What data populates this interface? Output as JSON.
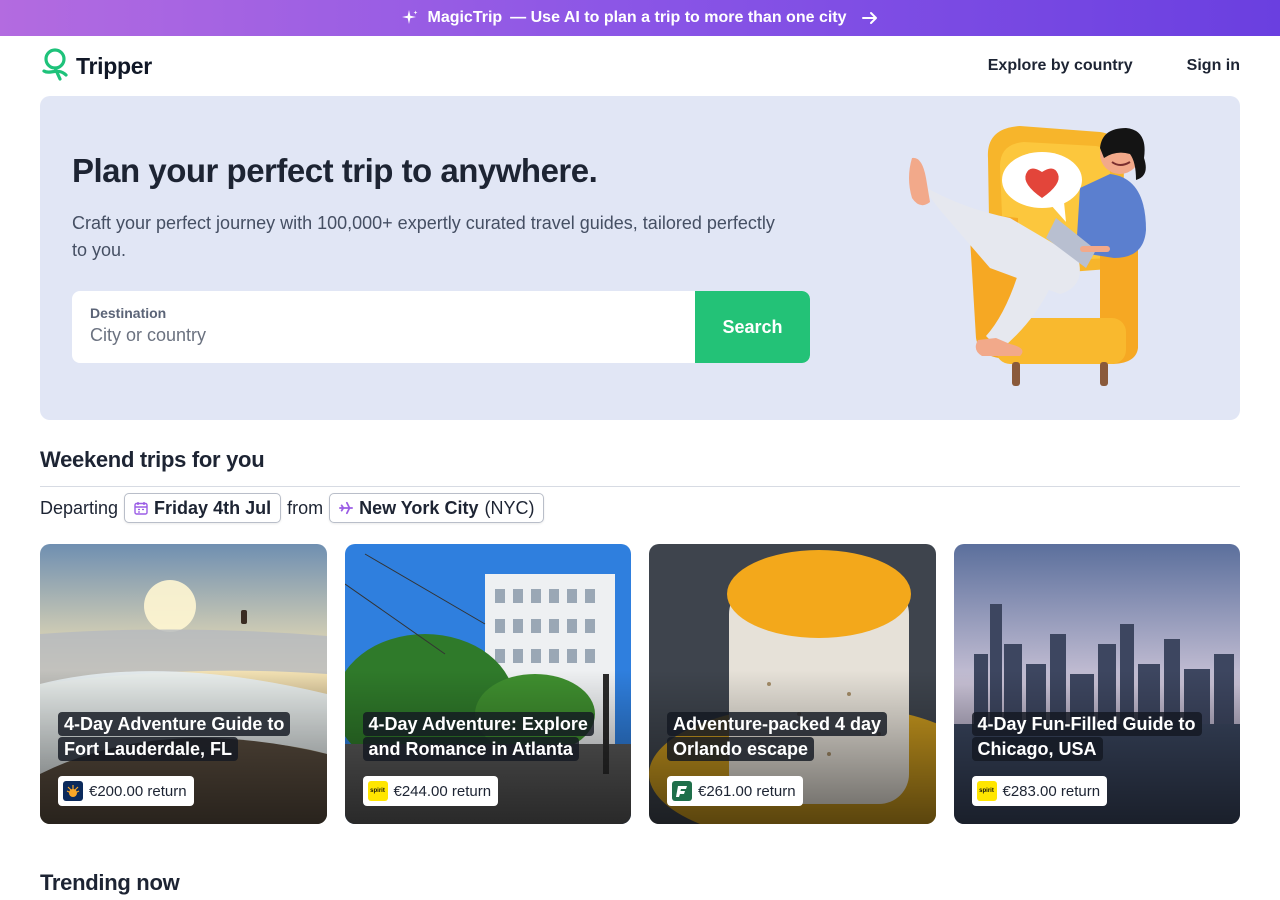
{
  "promo": {
    "brand": "MagicTrip",
    "text": "— Use AI to plan a trip to more than one city",
    "colors": {
      "start": "#b36be0",
      "end": "#6a3fe0"
    }
  },
  "header": {
    "logo_text": "Tripper",
    "nav": {
      "explore_label": "Explore by country",
      "signin_label": "Sign in"
    }
  },
  "hero": {
    "title": "Plan your perfect trip to anywhere.",
    "subtitle": "Craft your perfect journey with 100,000+ expertly curated travel guides, tailored perfectly to you.",
    "search": {
      "label": "Destination",
      "placeholder": "City or country",
      "value": "",
      "button_label": "Search"
    },
    "accent_color": "#23c277"
  },
  "weekend": {
    "title": "Weekend trips for you",
    "departing_label": "Departing",
    "date": "Friday 4th Jul",
    "from_label": "from",
    "city": "New York City",
    "city_code": "(NYC)",
    "cards": [
      {
        "title": "4-Day Adventure Guide to Fort Lauderdale, FL",
        "price": "€200.00 return",
        "airline_icon": "jetblue-sun-icon"
      },
      {
        "title": "4-Day Adventure: Explore and Romance in Atlanta",
        "price": "€244.00 return",
        "airline_icon": "spirit-icon"
      },
      {
        "title": "Adventure-packed 4 day Orlando escape",
        "price": "€261.00 return",
        "airline_icon": "frontier-icon"
      },
      {
        "title": "4-Day Fun-Filled Guide to Chicago, USA",
        "price": "€283.00 return",
        "airline_icon": "spirit-icon"
      }
    ]
  },
  "trending": {
    "title": "Trending now"
  }
}
